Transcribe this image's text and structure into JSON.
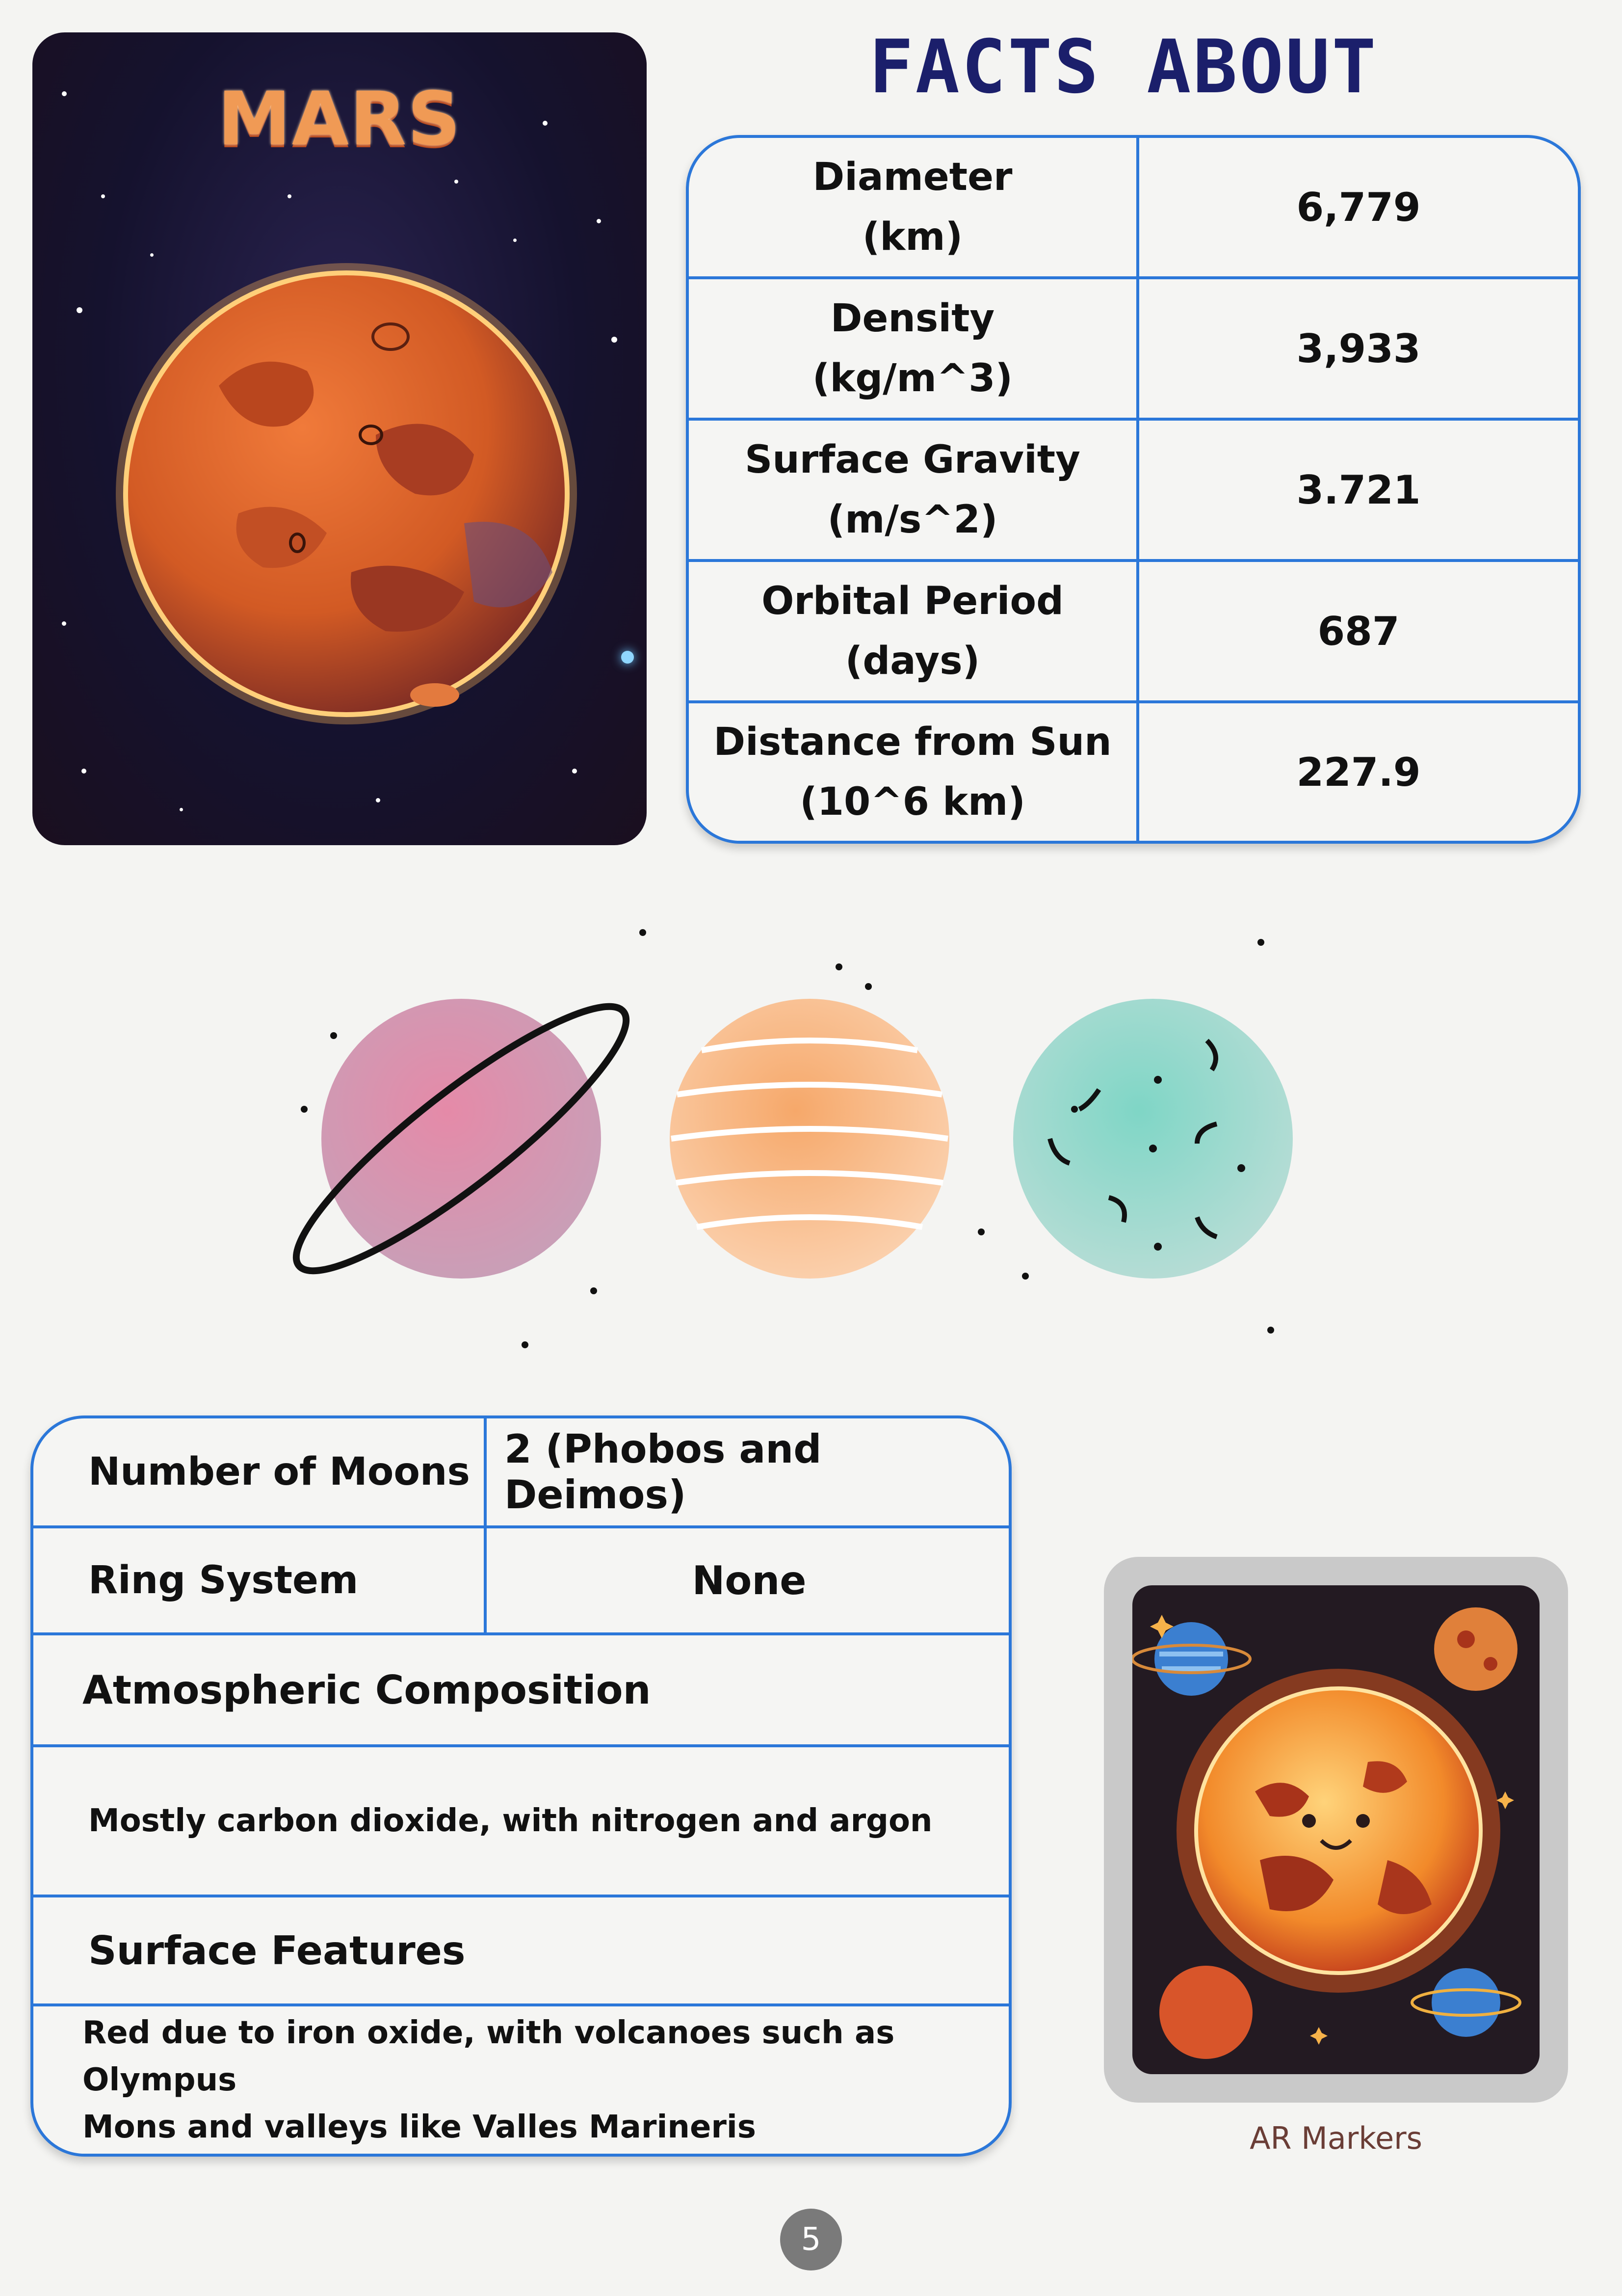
{
  "mars_card": {
    "title": "MARS"
  },
  "facts": {
    "title": "FACTS ABOUT",
    "rows": [
      {
        "label_line1": "Diameter",
        "label_line2": "(km)",
        "value": "6,779"
      },
      {
        "label_line1": "Density",
        "label_line2": "(kg/m^3)",
        "value": "3,933"
      },
      {
        "label_line1": "Surface Gravity",
        "label_line2": "(m/s^2)",
        "value": "3.721"
      },
      {
        "label_line1": "Orbital Period",
        "label_line2": "(days)",
        "value": "687"
      },
      {
        "label_line1": "Distance from Sun",
        "label_line2": "(10^6 km)",
        "value": "227.9"
      }
    ]
  },
  "details": {
    "moons_label": "Number of Moons",
    "moons_value": "2 (Phobos and Deimos)",
    "rings_label": "Ring System",
    "rings_value": "None",
    "atmosphere_heading": "Atmospheric Composition",
    "atmosphere_text": "Mostly carbon dioxide, with nitrogen and argon",
    "surface_heading": "Surface Features",
    "surface_text_line1": "Red due to iron oxide, with volcanoes such as Olympus",
    "surface_text_line2": "Mons and valleys like Valles Marineris"
  },
  "ar_marker": {
    "caption": "AR Markers"
  },
  "page": {
    "number": "5"
  },
  "colors": {
    "accent_border": "#2b77d9",
    "title_navy": "#1b1f6b",
    "mars_orange": "#e0632b"
  }
}
